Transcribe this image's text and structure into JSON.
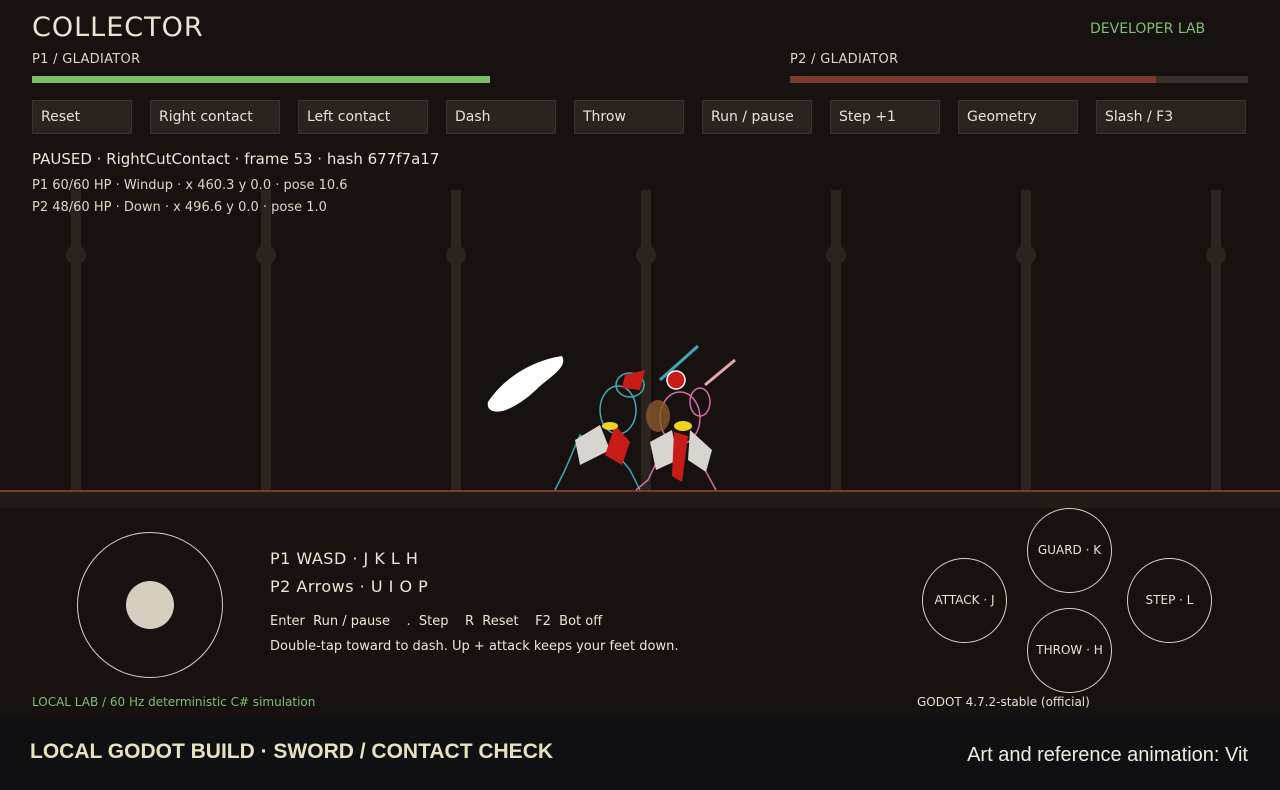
{
  "title": "COLLECTOR",
  "developer_lab": "DEVELOPER LAB",
  "p1": {
    "label": "P1  /  GLADIATOR",
    "health_fraction": 1.0,
    "bar_color": "#7dbf67"
  },
  "p2": {
    "label": "P2  /  GLADIATOR",
    "health_fraction": 0.8,
    "bar_color": "#7a3a2c"
  },
  "buttons": [
    "Reset",
    "Right contact",
    "Left contact",
    "Dash",
    "Throw",
    "Run / pause",
    "Step +1",
    "Geometry",
    "Slash / F3"
  ],
  "status_line": "PAUSED  ·  RightCutContact  ·  frame 53  ·  hash 677f7a17",
  "p1_info": "P1  60/60 HP  ·  Windup  ·  x 460.3  y 0.0  ·  pose 10.6",
  "p2_info": "P2  48/60 HP  ·  Down  ·  x 496.6  y 0.0  ·  pose 1.0",
  "controls": {
    "p1": "P1  WASD · J K L H",
    "p2": "P2  Arrows · U I O P",
    "keys": "Enter  Run / pause    .  Step    R  Reset    F2  Bot off",
    "hint": "Double-tap toward to dash. Up + attack keeps your feet down."
  },
  "action_buttons": {
    "guard": "GUARD · K",
    "attack": "ATTACK · J",
    "step": "STEP · L",
    "throw": "THROW · H"
  },
  "local_lab": "LOCAL LAB  /  60 Hz deterministic C# simulation",
  "engine": "GODOT 4.7.2-stable (official)",
  "footer_left": "LOCAL GODOT BUILD · SWORD / CONTACT CHECK",
  "footer_right": "Art and reference animation: Vit",
  "colors": {
    "accent_green": "#7fbe6e",
    "floor_line": "#7a3a2c",
    "background": "#17120f"
  }
}
